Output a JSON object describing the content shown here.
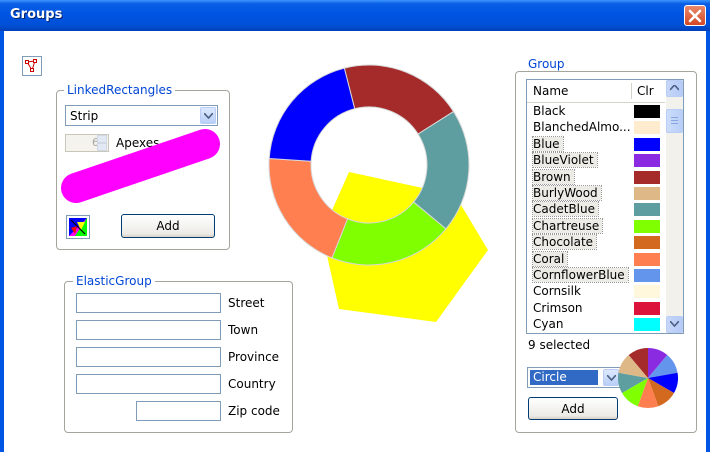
{
  "window": {
    "title": "Groups"
  },
  "linked": {
    "group_label": "LinkedRectangles",
    "shape_select": "Strip",
    "apexes_value": "6",
    "apexes_label": "Apexes",
    "add_label": "Add"
  },
  "elastic": {
    "group_label": "ElasticGroup",
    "street_label": "Street",
    "town_label": "Town",
    "province_label": "Province",
    "country_label": "Country",
    "zip_label": "Zip code"
  },
  "group": {
    "group_label": "Group",
    "col_name": "Name",
    "col_clr": "Clr",
    "items": [
      {
        "name": "Black",
        "color": "#000000",
        "selected": false
      },
      {
        "name": "BlanchedAlmo...",
        "color": "#ffebcd",
        "selected": false
      },
      {
        "name": "Blue",
        "color": "#0000ff",
        "selected": true
      },
      {
        "name": "BlueViolet",
        "color": "#8a2be2",
        "selected": true
      },
      {
        "name": "Brown",
        "color": "#a52a2a",
        "selected": true
      },
      {
        "name": "BurlyWood",
        "color": "#deb887",
        "selected": true
      },
      {
        "name": "CadetBlue",
        "color": "#5f9ea0",
        "selected": true
      },
      {
        "name": "Chartreuse",
        "color": "#7fff00",
        "selected": true
      },
      {
        "name": "Chocolate",
        "color": "#d2691e",
        "selected": true
      },
      {
        "name": "Coral",
        "color": "#ff7f50",
        "selected": true
      },
      {
        "name": "CornflowerBlue",
        "color": "#6495ed",
        "selected": true
      },
      {
        "name": "Cornsilk",
        "color": "#fff8dc",
        "selected": false
      },
      {
        "name": "Crimson",
        "color": "#dc143c",
        "selected": false
      },
      {
        "name": "Cyan",
        "color": "#00ffff",
        "selected": false
      }
    ],
    "selected_count": "9 selected",
    "shape_select": "Circle",
    "add_label": "Add"
  },
  "donut": {
    "segments": [
      {
        "color": "#a52a2a",
        "value": 1
      },
      {
        "color": "#5f9ea0",
        "value": 1
      },
      {
        "color": "#7fff00",
        "value": 1
      },
      {
        "color": "#ff7f50",
        "value": 1
      },
      {
        "color": "#0000ff",
        "value": 1
      }
    ],
    "hexagon_color": "#ffff00"
  },
  "mini_pie": {
    "segments": [
      "#8a2be2",
      "#6495ed",
      "#0000ff",
      "#d2691e",
      "#ff7f50",
      "#7fff00",
      "#5f9ea0",
      "#deb887",
      "#a52a2a"
    ]
  }
}
